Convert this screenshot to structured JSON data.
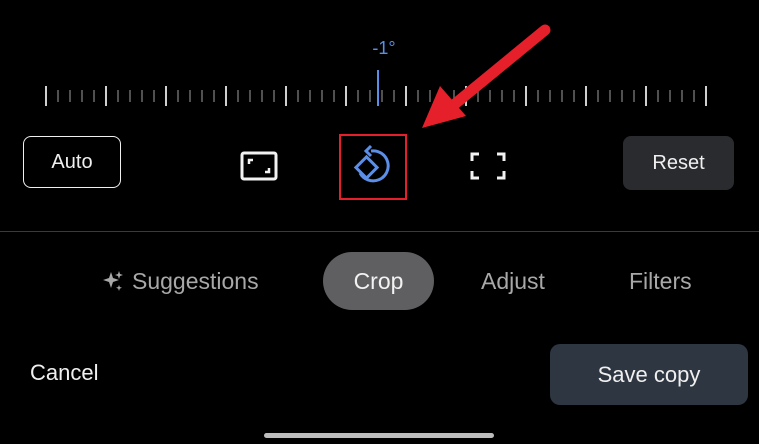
{
  "rotation": {
    "angle_label": "-1°",
    "angle_value": -1
  },
  "tools": {
    "auto_label": "Auto",
    "reset_label": "Reset",
    "aspect_icon": "aspect-ratio-icon",
    "rotate_icon": "rotate-icon",
    "freeform_icon": "freeform-crop-icon"
  },
  "tabs": [
    {
      "label": "Suggestions",
      "icon": "sparkle-icon"
    },
    {
      "label": "Crop",
      "selected": true
    },
    {
      "label": "Adjust"
    },
    {
      "label": "Filters"
    }
  ],
  "actions": {
    "cancel_label": "Cancel",
    "save_label": "Save copy"
  },
  "colors": {
    "accent_blue": "#5b8ee6",
    "highlight_red": "#e5202a",
    "selected_tab_bg": "#5f5f61",
    "save_button_bg": "#2e3641"
  }
}
